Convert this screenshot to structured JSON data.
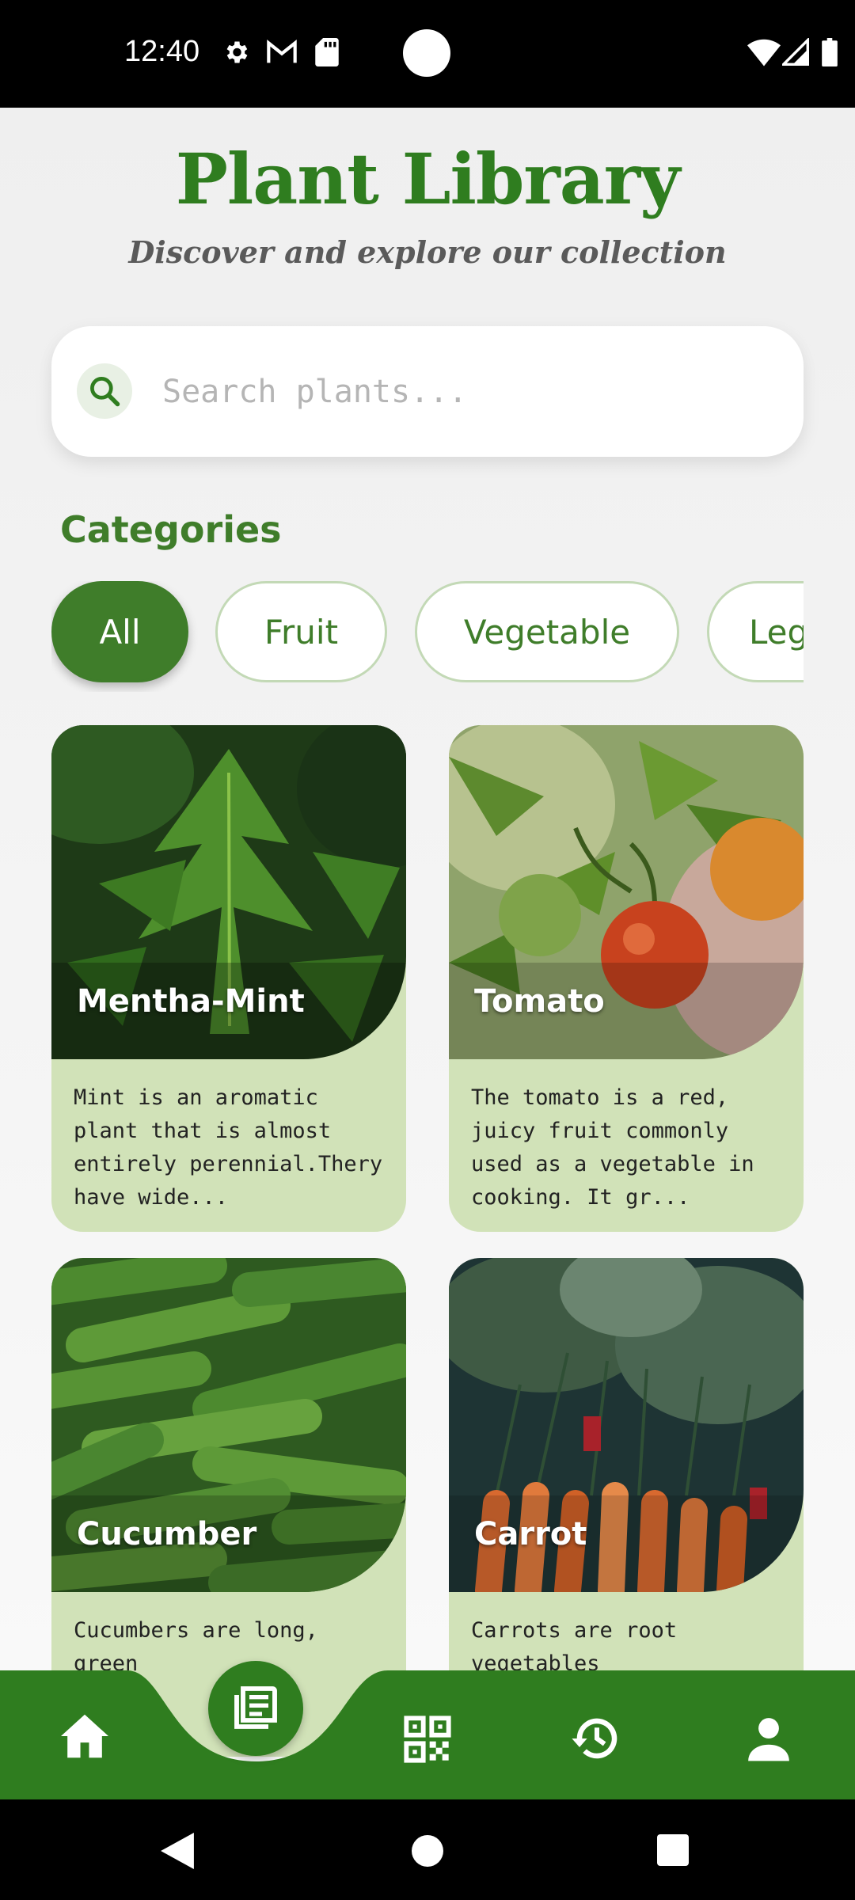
{
  "status_bar": {
    "time": "12:40"
  },
  "header": {
    "title": "Plant Library",
    "subtitle": "Discover and explore our collection"
  },
  "search": {
    "placeholder": "Search plants..."
  },
  "categories": {
    "title": "Categories",
    "items": [
      "All",
      "Fruit",
      "Vegetable",
      "Leg"
    ],
    "selected": "All"
  },
  "plants": [
    {
      "name": "Mentha-Mint",
      "description": "Mint is an aromatic plant that is almost entirely perennial.Thery have wide..."
    },
    {
      "name": "Tomato",
      "description": "The tomato is a red, juicy fruit commonly used as a vegetable in cooking. It gr..."
    },
    {
      "name": "Cucumber",
      "description": "Cucumbers are long, green"
    },
    {
      "name": "Carrot",
      "description": "Carrots are root vegetables"
    }
  ],
  "nav": {
    "items": [
      "home-icon",
      "library-icon",
      "qr-code-icon",
      "history-icon",
      "profile-icon"
    ],
    "active": "library-icon"
  },
  "colors": {
    "brand": "#2f7d1f",
    "card_bg": "#d1e2b8",
    "chip_border": "#c3d9b6"
  }
}
